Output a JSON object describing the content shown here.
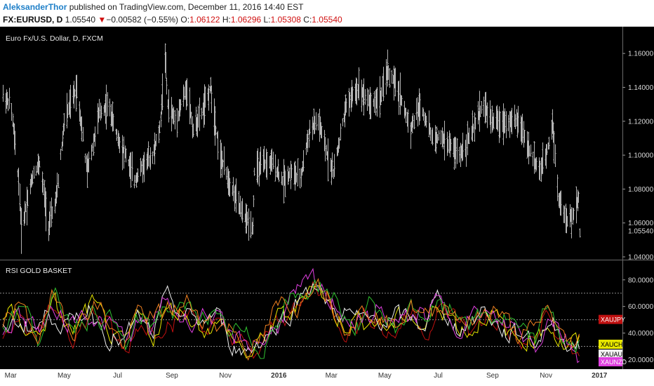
{
  "header": {
    "author": "AleksanderThor",
    "published_text": "published on TradingView.com, December 11, 2016 14:40 EST",
    "symbol": "FX:EURUSD, D",
    "last": "1.05540",
    "change_arrow": "▼",
    "change": "−0.00582 (−0.55%)",
    "o_label": "O:",
    "o_value": "1.06122",
    "h_label": "H:",
    "h_value": "1.06296",
    "l_label": "L:",
    "l_value": "1.05308",
    "c_label": "C:",
    "c_value": "1.05540"
  },
  "colors": {
    "background": "#000000",
    "price_bars": "#b4b4b4",
    "up_down_red": "#d01010",
    "author_blue": "#1e7fc8"
  },
  "chart_data": [
    {
      "type": "ohlc",
      "title": "Euro Fx/U.S. Dollar, D, FXCM",
      "ylim": [
        1.04,
        1.17
      ],
      "y_ticks": [
        "1.16000",
        "1.14000",
        "1.12000",
        "1.10000",
        "1.08000",
        "1.06000",
        "1.04000"
      ],
      "last_price_label": "1.05540",
      "x_ticks": [
        "Mar",
        "May",
        "Jul",
        "Sep",
        "Nov",
        "2016",
        "Mar",
        "May",
        "Jul",
        "Sep",
        "Nov",
        "2017"
      ],
      "x_range": [
        "2015-02-20",
        "2016-12-31"
      ],
      "anchors": [
        [
          "2015-02-20",
          1.135
        ],
        [
          "2015-03-01",
          1.13
        ],
        [
          "2015-03-05",
          1.11
        ],
        [
          "2015-03-10",
          1.085
        ],
        [
          "2015-03-13",
          1.055
        ],
        [
          "2015-03-20",
          1.075
        ],
        [
          "2015-03-27",
          1.09
        ],
        [
          "2015-04-03",
          1.095
        ],
        [
          "2015-04-13",
          1.058
        ],
        [
          "2015-04-22",
          1.075
        ],
        [
          "2015-05-01",
          1.12
        ],
        [
          "2015-05-15",
          1.14
        ],
        [
          "2015-05-27",
          1.09
        ],
        [
          "2015-06-10",
          1.125
        ],
        [
          "2015-06-20",
          1.13
        ],
        [
          "2015-07-01",
          1.11
        ],
        [
          "2015-07-10",
          1.1
        ],
        [
          "2015-07-20",
          1.085
        ],
        [
          "2015-07-31",
          1.095
        ],
        [
          "2015-08-10",
          1.1
        ],
        [
          "2015-08-18",
          1.115
        ],
        [
          "2015-08-24",
          1.16
        ],
        [
          "2015-08-27",
          1.13
        ],
        [
          "2015-09-05",
          1.12
        ],
        [
          "2015-09-18",
          1.14
        ],
        [
          "2015-09-25",
          1.115
        ],
        [
          "2015-10-05",
          1.125
        ],
        [
          "2015-10-15",
          1.14
        ],
        [
          "2015-10-25",
          1.1
        ],
        [
          "2015-11-05",
          1.085
        ],
        [
          "2015-11-20",
          1.065
        ],
        [
          "2015-12-02",
          1.058
        ],
        [
          "2015-12-04",
          1.09
        ],
        [
          "2015-12-15",
          1.095
        ],
        [
          "2015-12-25",
          1.095
        ],
        [
          "2016-01-05",
          1.085
        ],
        [
          "2016-01-15",
          1.09
        ],
        [
          "2016-01-25",
          1.085
        ],
        [
          "2016-02-05",
          1.115
        ],
        [
          "2016-02-15",
          1.12
        ],
        [
          "2016-02-25",
          1.1
        ],
        [
          "2016-03-03",
          1.09
        ],
        [
          "2016-03-18",
          1.13
        ],
        [
          "2016-04-01",
          1.14
        ],
        [
          "2016-04-15",
          1.13
        ],
        [
          "2016-04-27",
          1.135
        ],
        [
          "2016-05-03",
          1.15
        ],
        [
          "2016-05-15",
          1.14
        ],
        [
          "2016-05-30",
          1.115
        ],
        [
          "2016-06-10",
          1.13
        ],
        [
          "2016-06-24",
          1.11
        ],
        [
          "2016-07-05",
          1.11
        ],
        [
          "2016-07-25",
          1.1
        ],
        [
          "2016-08-10",
          1.115
        ],
        [
          "2016-08-20",
          1.13
        ],
        [
          "2016-09-01",
          1.12
        ],
        [
          "2016-09-20",
          1.12
        ],
        [
          "2016-10-01",
          1.12
        ],
        [
          "2016-10-15",
          1.1
        ],
        [
          "2016-10-25",
          1.09
        ],
        [
          "2016-11-01",
          1.1
        ],
        [
          "2016-11-08",
          1.12
        ],
        [
          "2016-11-15",
          1.075
        ],
        [
          "2016-11-25",
          1.06
        ],
        [
          "2016-12-02",
          1.065
        ],
        [
          "2016-12-08",
          1.075
        ],
        [
          "2016-12-09",
          1.0554
        ]
      ]
    },
    {
      "type": "line",
      "title": "RSI GOLD BASKET",
      "ylim": [
        15,
        92
      ],
      "y_ticks": [
        "80.0000",
        "60.0000",
        "40.0000",
        "20.0000"
      ],
      "levels": [
        70,
        50,
        30
      ],
      "series": [
        {
          "name": "XAUJPY",
          "color": "#c01010",
          "last": 50
        },
        {
          "name": "XAUCHF",
          "color": "#e6e600",
          "last": 33
        },
        {
          "name": "XAUAUD",
          "color": "#f0f0f0",
          "last": 27
        },
        {
          "name": "XAUNZD",
          "color": "#e040e0",
          "last": 21
        }
      ],
      "extra_series_colors": [
        "#30c030",
        "#f08020"
      ],
      "anchors": [
        [
          "2015-02-20",
          45
        ],
        [
          "2015-03-10",
          55
        ],
        [
          "2015-04-01",
          40
        ],
        [
          "2015-04-20",
          60
        ],
        [
          "2015-05-10",
          45
        ],
        [
          "2015-06-01",
          58
        ],
        [
          "2015-06-20",
          45
        ],
        [
          "2015-07-10",
          30
        ],
        [
          "2015-07-25",
          50
        ],
        [
          "2015-08-10",
          42
        ],
        [
          "2015-08-25",
          60
        ],
        [
          "2015-09-10",
          55
        ],
        [
          "2015-10-01",
          52
        ],
        [
          "2015-10-20",
          50
        ],
        [
          "2015-11-05",
          38
        ],
        [
          "2015-12-01",
          28
        ],
        [
          "2015-12-15",
          35
        ],
        [
          "2016-01-05",
          55
        ],
        [
          "2016-01-25",
          65
        ],
        [
          "2016-02-10",
          80
        ],
        [
          "2016-02-25",
          66
        ],
        [
          "2016-03-15",
          52
        ],
        [
          "2016-04-01",
          48
        ],
        [
          "2016-04-20",
          55
        ],
        [
          "2016-05-10",
          45
        ],
        [
          "2016-06-01",
          55
        ],
        [
          "2016-06-15",
          48
        ],
        [
          "2016-07-01",
          62
        ],
        [
          "2016-07-20",
          50
        ],
        [
          "2016-08-10",
          48
        ],
        [
          "2016-08-25",
          55
        ],
        [
          "2016-09-15",
          45
        ],
        [
          "2016-10-01",
          38
        ],
        [
          "2016-10-20",
          35
        ],
        [
          "2016-11-05",
          55
        ],
        [
          "2016-11-20",
          35
        ],
        [
          "2016-12-09",
          28
        ]
      ]
    }
  ]
}
